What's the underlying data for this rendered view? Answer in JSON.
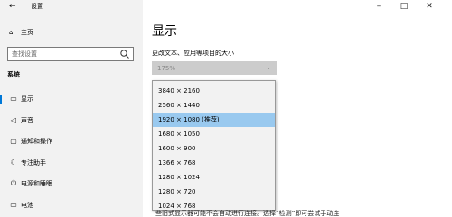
{
  "window": {
    "title": "设置",
    "back_icon": "back-arrow-icon",
    "min_icon": "minimize-icon",
    "max_icon": "maximize-icon",
    "close_icon": "close-icon"
  },
  "sidebar": {
    "home_label": "主页",
    "search_placeholder": "查找设置",
    "section_title": "系统",
    "items": [
      {
        "label": "显示",
        "icon": "monitor-icon",
        "active": true
      },
      {
        "label": "声音",
        "icon": "speaker-icon",
        "active": false
      },
      {
        "label": "通知和操作",
        "icon": "notification-icon",
        "active": false
      },
      {
        "label": "专注助手",
        "icon": "moon-icon",
        "active": false
      },
      {
        "label": "电源和睡眠",
        "icon": "power-icon",
        "active": false
      },
      {
        "label": "电池",
        "icon": "battery-icon",
        "active": false
      }
    ]
  },
  "main": {
    "heading": "显示",
    "scale_label": "更改文本、应用等项目的大小",
    "scale_value": "175%",
    "resolution_options": [
      "3840 × 2160",
      "2560 × 1440",
      "1920 × 1080 (推荐)",
      "1680 × 1050",
      "1600 × 900",
      "1366 × 768",
      "1280 × 1024",
      "1280 × 720",
      "1024 × 768"
    ],
    "selected_index": 2,
    "footnote": "些旧式显示器可能不会自动进行连接。选择“检测”即可尝试手动连"
  },
  "colors": {
    "sidebar_bg": "#f2f2f2",
    "accent": "#0078d7",
    "selected_option": "#99c9ef"
  }
}
